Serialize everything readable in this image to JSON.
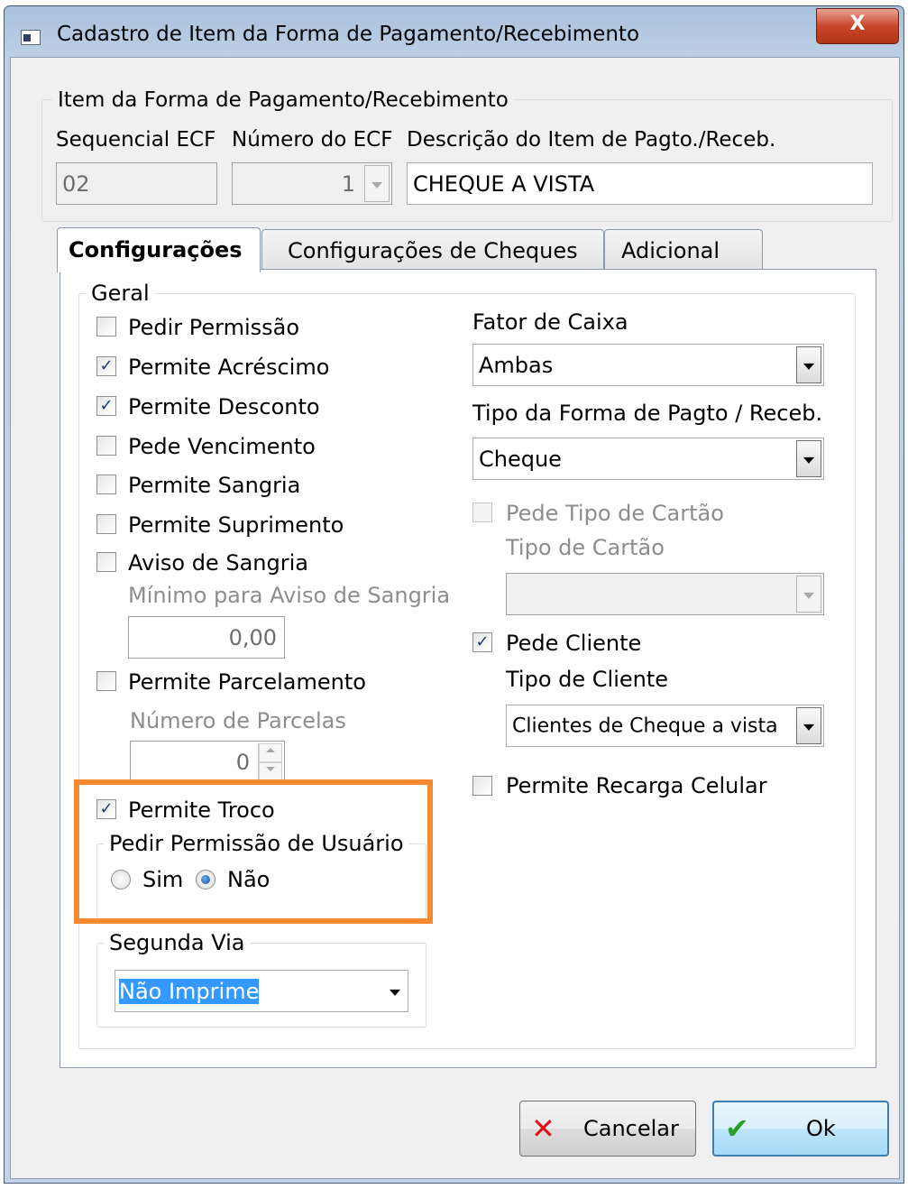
{
  "window": {
    "title": "Cadastro de Item da Forma de Pagamento/Recebimento",
    "close_glyph": "X"
  },
  "item_group": {
    "legend": "Item da Forma de Pagamento/Recebimento",
    "sequencial_label": "Sequencial ECF",
    "sequencial_value": "02",
    "numero_label": "Número do ECF",
    "numero_value": "1",
    "descricao_label": "Descrição do Item de Pagto./Receb.",
    "descricao_value": "CHEQUE A VISTA"
  },
  "tabs": [
    {
      "label": "Configurações",
      "active": true
    },
    {
      "label": "Configurações de Cheques",
      "active": false
    },
    {
      "label": "Adicional",
      "active": false
    }
  ],
  "geral": {
    "legend": "Geral",
    "checkboxes": [
      {
        "label": "Pedir Permissão",
        "checked": false
      },
      {
        "label": "Permite Acréscimo",
        "checked": true
      },
      {
        "label": "Permite Desconto",
        "checked": true
      },
      {
        "label": "Pede Vencimento",
        "checked": false
      },
      {
        "label": "Permite Sangria",
        "checked": false
      },
      {
        "label": "Permite Suprimento",
        "checked": false
      },
      {
        "label": "Aviso de Sangria",
        "checked": false
      }
    ],
    "minimo_label": "Mínimo para Aviso de Sangria",
    "minimo_value": "0,00",
    "parcelamento_label": "Permite Parcelamento",
    "parcelamento_checked": false,
    "parcelas_label": "Número de Parcelas",
    "parcelas_value": "0",
    "troco_label": "Permite Troco",
    "troco_checked": true,
    "permissao_usuario": {
      "legend": "Pedir Permissão de Usuário",
      "options": [
        "Sim",
        "Não"
      ],
      "selected": "Não"
    },
    "segunda_via": {
      "legend": "Segunda Via",
      "value": "Não Imprime"
    },
    "fator_caixa_label": "Fator de Caixa",
    "fator_caixa_value": "Ambas",
    "tipo_forma_label": "Tipo da Forma de Pagto / Receb.",
    "tipo_forma_value": "Cheque",
    "pede_tipo_cartao_label": "Pede Tipo de Cartão",
    "pede_tipo_cartao_checked": false,
    "tipo_cartao_label": "Tipo de Cartão",
    "tipo_cartao_value": "",
    "pede_cliente_label": "Pede Cliente",
    "pede_cliente_checked": true,
    "tipo_cliente_label": "Tipo de Cliente",
    "tipo_cliente_value": "Clientes de Cheque a vista",
    "recarga_label": "Permite Recarga Celular",
    "recarga_checked": false
  },
  "buttons": {
    "cancel_label": "Cancelar",
    "ok_label": "Ok"
  },
  "colors": {
    "highlight_box": "#f78930",
    "cancel_icon": "#e0101a",
    "ok_icon": "#2aa02a"
  },
  "check_glyph": "✓"
}
